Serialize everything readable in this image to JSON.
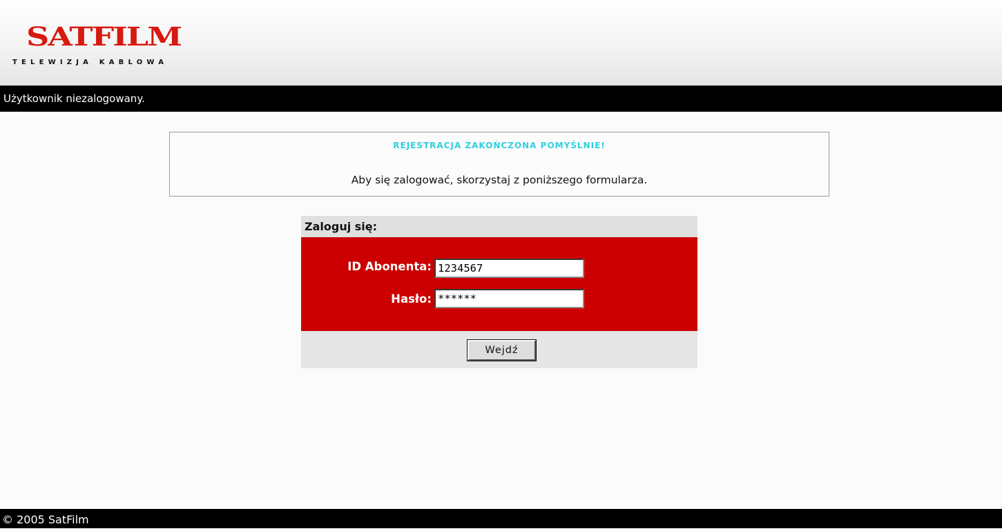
{
  "header": {
    "logo_text": "SATFILM",
    "logo_tagline": "TELEWIZJA KABLOWA"
  },
  "status": {
    "text": "Użytkownik niezalogowany."
  },
  "message": {
    "title": "REJESTRACJA ZAKOŃCZONA POMYŚLNIE!",
    "text": "Aby się zalogować, skorzystaj z poniższego formularza.",
    "title_color": "#2fd0e0"
  },
  "login": {
    "heading": "Zaloguj się:",
    "id_label": "ID Abonenta:",
    "id_value": "1234567",
    "password_label": "Hasło:",
    "password_value": "******",
    "submit_label": "Wejdź",
    "panel_color": "#cc0000"
  },
  "footer": {
    "copyright": "© 2005 SatFilm"
  },
  "colors": {
    "brand_red": "#d71910",
    "bar_black": "#000000"
  }
}
